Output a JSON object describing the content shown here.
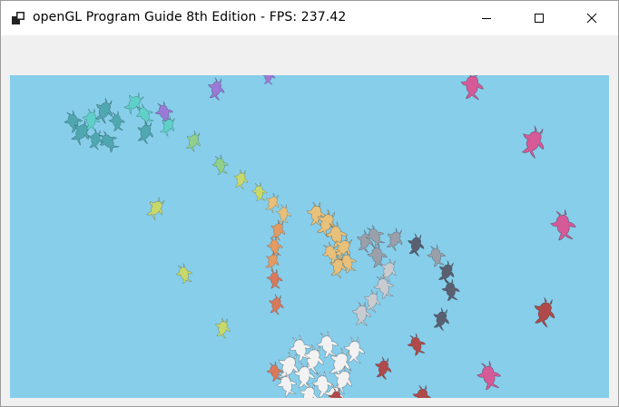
{
  "window": {
    "title": "openGL Program Guide 8th Edition - FPS: 237.42",
    "app_icon": "window-app-icon",
    "controls": [
      {
        "name": "minimize-icon"
      },
      {
        "name": "maximize-icon"
      },
      {
        "name": "close-icon"
      }
    ]
  },
  "scene": {
    "background_color": "#87ceeb",
    "object_icon": "armadillo-model-icon",
    "color_palette": {
      "teal": "#4fa8b0",
      "cyan": "#5fd0c8",
      "green": "#8fd08a",
      "yellow_green": "#c8d86a",
      "tan": "#e8c07a",
      "orange": "#e59a62",
      "salmon": "#d9785a",
      "purple": "#9a7ad6",
      "magenta": "#d65a98",
      "red_brown": "#b04a4a",
      "gray": "#9aa0aa",
      "light_gray": "#c8ccd0",
      "white": "#f2f2f2",
      "dark_slate": "#5a6070"
    }
  }
}
